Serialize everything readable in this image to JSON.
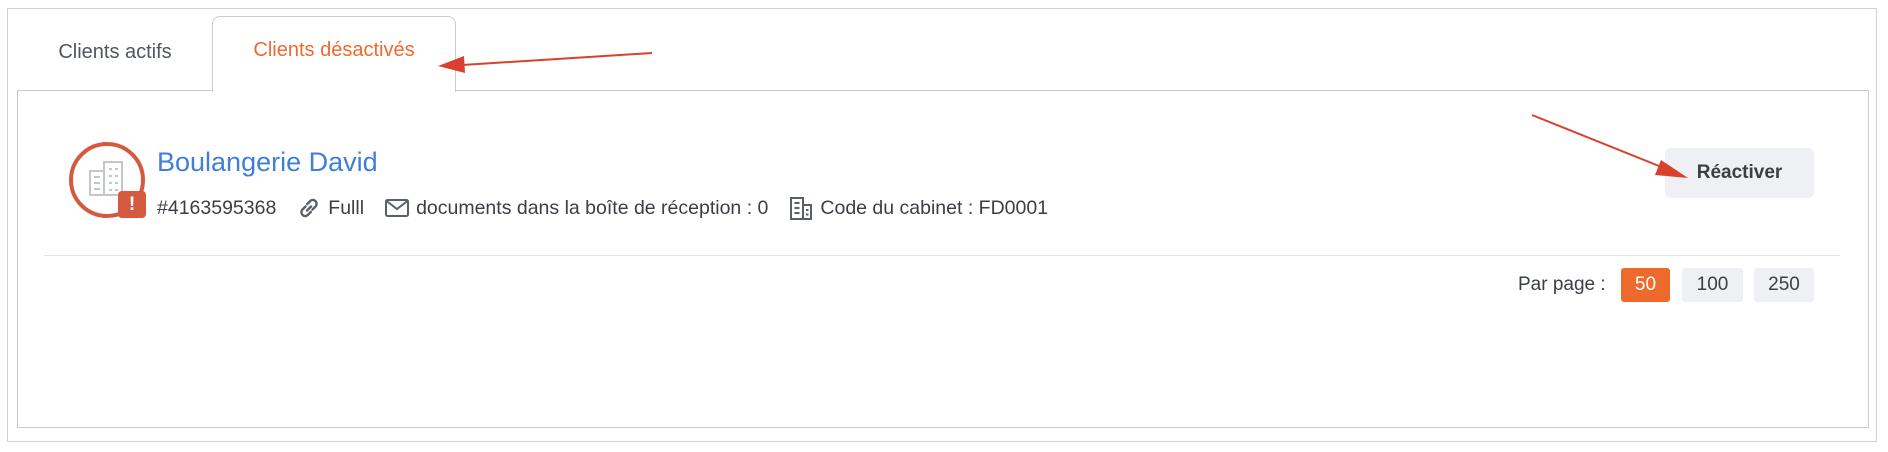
{
  "tabs": [
    {
      "label": "Clients actifs",
      "active": false
    },
    {
      "label": "Clients désactivés",
      "active": true
    }
  ],
  "client": {
    "name": "Boulangerie David",
    "id_text": "#4163595368",
    "link_label": "Fulll",
    "inbox_text": "documents dans la boîte de réception : 0",
    "office_code_text": "Code du cabinet : FD0001",
    "alert_badge": "!",
    "avatar_icon": "building-icon"
  },
  "actions": {
    "reactivate_label": "Réactiver"
  },
  "pagination": {
    "label": "Par page :",
    "options": [
      "50",
      "100",
      "250"
    ],
    "selected": "50"
  },
  "colors": {
    "accent": "#ee6a2c",
    "link": "#3f7fd9",
    "alert": "#d35a3f",
    "annotation_arrow": "#d9412e"
  }
}
